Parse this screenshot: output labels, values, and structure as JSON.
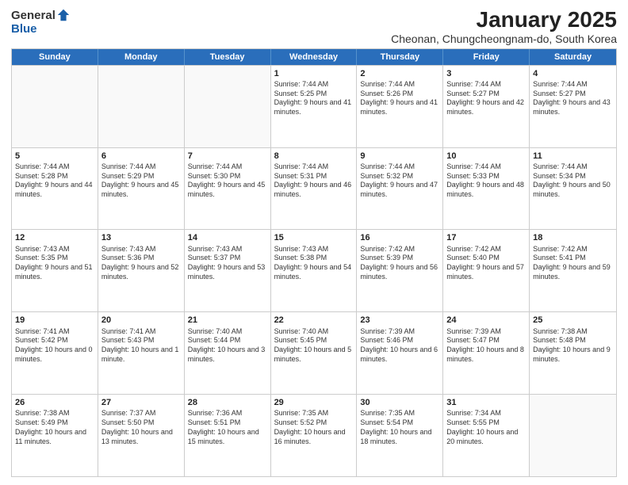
{
  "logo": {
    "general": "General",
    "blue": "Blue"
  },
  "title": "January 2025",
  "location": "Cheonan, Chungcheongnam-do, South Korea",
  "days_of_week": [
    "Sunday",
    "Monday",
    "Tuesday",
    "Wednesday",
    "Thursday",
    "Friday",
    "Saturday"
  ],
  "weeks": [
    [
      {
        "day": "",
        "info": "",
        "empty": true
      },
      {
        "day": "",
        "info": "",
        "empty": true
      },
      {
        "day": "",
        "info": "",
        "empty": true
      },
      {
        "day": "1",
        "info": "Sunrise: 7:44 AM\nSunset: 5:25 PM\nDaylight: 9 hours and 41 minutes.",
        "empty": false
      },
      {
        "day": "2",
        "info": "Sunrise: 7:44 AM\nSunset: 5:26 PM\nDaylight: 9 hours and 41 minutes.",
        "empty": false
      },
      {
        "day": "3",
        "info": "Sunrise: 7:44 AM\nSunset: 5:27 PM\nDaylight: 9 hours and 42 minutes.",
        "empty": false
      },
      {
        "day": "4",
        "info": "Sunrise: 7:44 AM\nSunset: 5:27 PM\nDaylight: 9 hours and 43 minutes.",
        "empty": false
      }
    ],
    [
      {
        "day": "5",
        "info": "Sunrise: 7:44 AM\nSunset: 5:28 PM\nDaylight: 9 hours and 44 minutes.",
        "empty": false
      },
      {
        "day": "6",
        "info": "Sunrise: 7:44 AM\nSunset: 5:29 PM\nDaylight: 9 hours and 45 minutes.",
        "empty": false
      },
      {
        "day": "7",
        "info": "Sunrise: 7:44 AM\nSunset: 5:30 PM\nDaylight: 9 hours and 45 minutes.",
        "empty": false
      },
      {
        "day": "8",
        "info": "Sunrise: 7:44 AM\nSunset: 5:31 PM\nDaylight: 9 hours and 46 minutes.",
        "empty": false
      },
      {
        "day": "9",
        "info": "Sunrise: 7:44 AM\nSunset: 5:32 PM\nDaylight: 9 hours and 47 minutes.",
        "empty": false
      },
      {
        "day": "10",
        "info": "Sunrise: 7:44 AM\nSunset: 5:33 PM\nDaylight: 9 hours and 48 minutes.",
        "empty": false
      },
      {
        "day": "11",
        "info": "Sunrise: 7:44 AM\nSunset: 5:34 PM\nDaylight: 9 hours and 50 minutes.",
        "empty": false
      }
    ],
    [
      {
        "day": "12",
        "info": "Sunrise: 7:43 AM\nSunset: 5:35 PM\nDaylight: 9 hours and 51 minutes.",
        "empty": false
      },
      {
        "day": "13",
        "info": "Sunrise: 7:43 AM\nSunset: 5:36 PM\nDaylight: 9 hours and 52 minutes.",
        "empty": false
      },
      {
        "day": "14",
        "info": "Sunrise: 7:43 AM\nSunset: 5:37 PM\nDaylight: 9 hours and 53 minutes.",
        "empty": false
      },
      {
        "day": "15",
        "info": "Sunrise: 7:43 AM\nSunset: 5:38 PM\nDaylight: 9 hours and 54 minutes.",
        "empty": false
      },
      {
        "day": "16",
        "info": "Sunrise: 7:42 AM\nSunset: 5:39 PM\nDaylight: 9 hours and 56 minutes.",
        "empty": false
      },
      {
        "day": "17",
        "info": "Sunrise: 7:42 AM\nSunset: 5:40 PM\nDaylight: 9 hours and 57 minutes.",
        "empty": false
      },
      {
        "day": "18",
        "info": "Sunrise: 7:42 AM\nSunset: 5:41 PM\nDaylight: 9 hours and 59 minutes.",
        "empty": false
      }
    ],
    [
      {
        "day": "19",
        "info": "Sunrise: 7:41 AM\nSunset: 5:42 PM\nDaylight: 10 hours and 0 minutes.",
        "empty": false
      },
      {
        "day": "20",
        "info": "Sunrise: 7:41 AM\nSunset: 5:43 PM\nDaylight: 10 hours and 1 minute.",
        "empty": false
      },
      {
        "day": "21",
        "info": "Sunrise: 7:40 AM\nSunset: 5:44 PM\nDaylight: 10 hours and 3 minutes.",
        "empty": false
      },
      {
        "day": "22",
        "info": "Sunrise: 7:40 AM\nSunset: 5:45 PM\nDaylight: 10 hours and 5 minutes.",
        "empty": false
      },
      {
        "day": "23",
        "info": "Sunrise: 7:39 AM\nSunset: 5:46 PM\nDaylight: 10 hours and 6 minutes.",
        "empty": false
      },
      {
        "day": "24",
        "info": "Sunrise: 7:39 AM\nSunset: 5:47 PM\nDaylight: 10 hours and 8 minutes.",
        "empty": false
      },
      {
        "day": "25",
        "info": "Sunrise: 7:38 AM\nSunset: 5:48 PM\nDaylight: 10 hours and 9 minutes.",
        "empty": false
      }
    ],
    [
      {
        "day": "26",
        "info": "Sunrise: 7:38 AM\nSunset: 5:49 PM\nDaylight: 10 hours and 11 minutes.",
        "empty": false
      },
      {
        "day": "27",
        "info": "Sunrise: 7:37 AM\nSunset: 5:50 PM\nDaylight: 10 hours and 13 minutes.",
        "empty": false
      },
      {
        "day": "28",
        "info": "Sunrise: 7:36 AM\nSunset: 5:51 PM\nDaylight: 10 hours and 15 minutes.",
        "empty": false
      },
      {
        "day": "29",
        "info": "Sunrise: 7:35 AM\nSunset: 5:52 PM\nDaylight: 10 hours and 16 minutes.",
        "empty": false
      },
      {
        "day": "30",
        "info": "Sunrise: 7:35 AM\nSunset: 5:54 PM\nDaylight: 10 hours and 18 minutes.",
        "empty": false
      },
      {
        "day": "31",
        "info": "Sunrise: 7:34 AM\nSunset: 5:55 PM\nDaylight: 10 hours and 20 minutes.",
        "empty": false
      },
      {
        "day": "",
        "info": "",
        "empty": true
      }
    ]
  ]
}
